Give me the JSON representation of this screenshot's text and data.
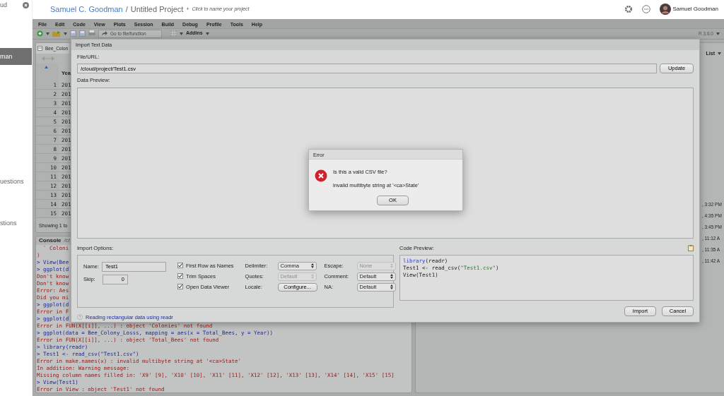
{
  "sidebar": {
    "items": [
      {
        "label": "ud",
        "selected": false
      },
      {
        "label": "man",
        "selected": true
      },
      {
        "label": "uestions",
        "selected": false
      },
      {
        "label": "stions",
        "selected": false
      }
    ]
  },
  "header": {
    "owner": "Samuel C. Goodman",
    "separator": "/",
    "project": "Untitled Project",
    "plus": "+",
    "hint": "Click to name your project",
    "user": "Samuel Goodman"
  },
  "menu": [
    "File",
    "Edit",
    "Code",
    "View",
    "Plots",
    "Session",
    "Build",
    "Debug",
    "Profile",
    "Tools",
    "Help"
  ],
  "toolbar": {
    "goto_placeholder": "Go to file/function",
    "addins": "Addins",
    "r_version": "R 3.6.0"
  },
  "data_viewer": {
    "tab": "Bee_Colon",
    "column": "Yea",
    "rows": [
      {
        "index": "1",
        "year": "201"
      },
      {
        "index": "2",
        "year": "201"
      },
      {
        "index": "3",
        "year": "201"
      },
      {
        "index": "4",
        "year": "201"
      },
      {
        "index": "5",
        "year": "201"
      },
      {
        "index": "6",
        "year": "201"
      },
      {
        "index": "7",
        "year": "201"
      },
      {
        "index": "8",
        "year": "201"
      },
      {
        "index": "9",
        "year": "201"
      },
      {
        "index": "10",
        "year": "201"
      },
      {
        "index": "11",
        "year": "201"
      },
      {
        "index": "12",
        "year": "201"
      },
      {
        "index": "13",
        "year": "201"
      },
      {
        "index": "14",
        "year": "201"
      },
      {
        "index": "15",
        "year": "201"
      }
    ],
    "footer": "Showing 1 to"
  },
  "console": {
    "tab": "Console",
    "path": "/cl",
    "lines": [
      {
        "text": "  ` Coloni",
        "kind": "error"
      },
      {
        "text": ")",
        "kind": "error"
      },
      {
        "text": "> View(Bee",
        "kind": "input"
      },
      {
        "text": "> ggplot(d",
        "kind": "input"
      },
      {
        "text": "Don't know",
        "kind": "error"
      },
      {
        "text": "Don't know",
        "kind": "error"
      },
      {
        "text": "Error: Aes",
        "kind": "error"
      },
      {
        "text": "Did you mi",
        "kind": "error"
      },
      {
        "text": "> ggplot(d",
        "kind": "input"
      },
      {
        "text": "Error in F",
        "kind": "error"
      },
      {
        "text": "> ggplot(d",
        "kind": "input"
      },
      {
        "text": "Error in FUN(X[[i]], ...) : object 'Colonies' not found",
        "kind": "error"
      },
      {
        "text": "> ggplot(data = Bee_Colony_Losss, mapping = aes(x = Total_Bees, y = Year))",
        "kind": "input"
      },
      {
        "text": "Error in FUN(X[[i]], ...) : object 'Total_Bees' not found",
        "kind": "error"
      },
      {
        "text": "> library(readr)",
        "kind": "input"
      },
      {
        "text": "> Test1 <- read_csv(\"Test1.csv\")",
        "kind": "input"
      },
      {
        "text": "Error in make.names(x) : invalid multibyte string at '<ca>State'",
        "kind": "error"
      },
      {
        "text": "In addition: Warning message:",
        "kind": "error"
      },
      {
        "text": "Missing column names filled in: 'X9' [9], 'X10' [10], 'X11' [11], 'X12' [12], 'X13' [13], 'X14' [14], 'X15' [15]",
        "kind": "error"
      },
      {
        "text": "> View(Test1)",
        "kind": "input"
      },
      {
        "text": "Error in View : object 'Test1' not found",
        "kind": "error"
      }
    ]
  },
  "environment": {
    "view_mode": "List",
    "times": [
      ", 3:32 PM",
      ", 4:35 PM",
      ", 3:45 PM",
      ", 11:12 A",
      ", 11:35 A",
      ", 11:42 A"
    ]
  },
  "import_dialog": {
    "title": "Import Text Data",
    "file_label": "File/URL:",
    "file_value": "/cloud/project/Test1.csv",
    "update": "Update",
    "preview_label": "Data Preview:",
    "options_label": "Import Options:",
    "name_label": "Name:",
    "name_value": "Test1",
    "skip_label": "Skip:",
    "skip_value": "0",
    "checks": [
      {
        "label": "First Row as Names",
        "checked": true
      },
      {
        "label": "Trim Spaces",
        "checked": true
      },
      {
        "label": "Open Data Viewer",
        "checked": true
      }
    ],
    "options": [
      {
        "label": "Delimiter:",
        "value": "Comma",
        "kind": "select",
        "disabled": false
      },
      {
        "label": "Escape:",
        "value": "None",
        "kind": "select",
        "disabled": true
      },
      {
        "label": "Quotes:",
        "value": "Default",
        "kind": "select",
        "disabled": true
      },
      {
        "label": "Comment:",
        "value": "Default",
        "kind": "select",
        "disabled": false
      },
      {
        "label": "Locale:",
        "value": "Configure...",
        "kind": "button",
        "disabled": false
      },
      {
        "label": "NA:",
        "value": "Default",
        "kind": "select",
        "disabled": false
      }
    ],
    "help_link": "Reading rectangular data using readr",
    "code_label": "Code Preview:",
    "code": [
      [
        {
          "text": "library",
          "kind": "keyword"
        },
        {
          "text": "(readr)",
          "kind": "plain"
        }
      ],
      [
        {
          "text": "Test1 <- read_csv(",
          "kind": "plain"
        },
        {
          "text": "\"Test1.csv\"",
          "kind": "string"
        },
        {
          "text": ")",
          "kind": "plain"
        }
      ],
      [
        {
          "text": "View(Test1)",
          "kind": "plain"
        }
      ]
    ],
    "import": "Import",
    "cancel": "Cancel"
  },
  "error_dialog": {
    "title": "Error",
    "heading": "Is this a valid CSV file?",
    "message": "invalid multibyte string at '<ca>State'",
    "ok": "OK"
  }
}
